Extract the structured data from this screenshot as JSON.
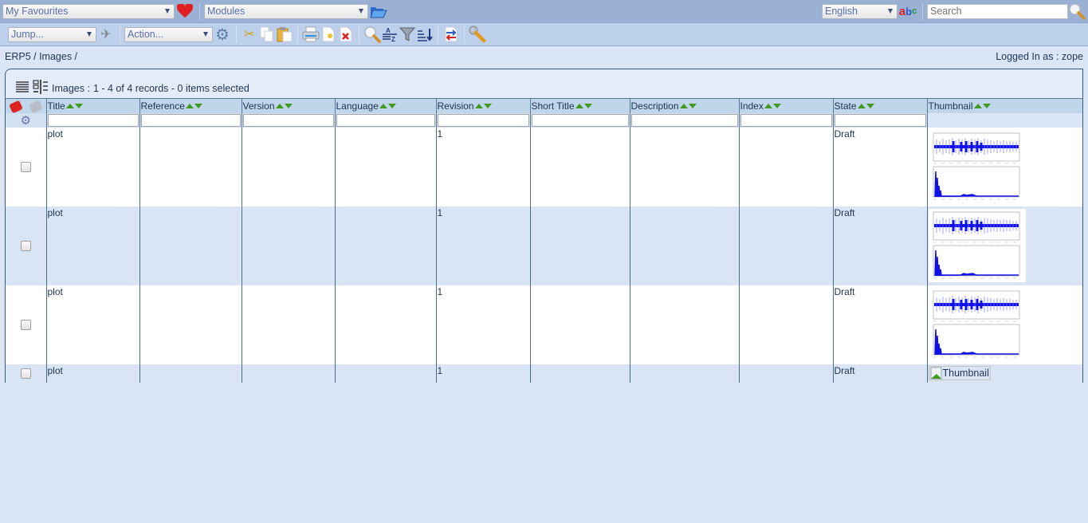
{
  "topbar": {
    "favourites": "My Favourites",
    "modules": "Modules",
    "language": "English",
    "search_placeholder": "Search"
  },
  "toolbar": {
    "jump": "Jump...",
    "action": "Action..."
  },
  "breadcrumb": "ERP5 / Images /",
  "logged_in": "Logged In as : zope",
  "listbox": {
    "title": "Images :",
    "summary": "1 - 4 of 4 records - 0 items selected",
    "columns": [
      "Title",
      "Reference",
      "Version",
      "Language",
      "Revision",
      "Short Title",
      "Description",
      "Index",
      "State",
      "Thumbnail"
    ],
    "rows": [
      {
        "title": "plot",
        "reference": "",
        "version": "",
        "language": "",
        "revision": "1",
        "short_title": "",
        "description": "",
        "index": "",
        "state": "Draft",
        "thumbnail": "image"
      },
      {
        "title": "plot",
        "reference": "",
        "version": "",
        "language": "",
        "revision": "1",
        "short_title": "",
        "description": "",
        "index": "",
        "state": "Draft",
        "thumbnail": "image"
      },
      {
        "title": "plot",
        "reference": "",
        "version": "",
        "language": "",
        "revision": "1",
        "short_title": "",
        "description": "",
        "index": "",
        "state": "Draft",
        "thumbnail": "image"
      },
      {
        "title": "plot",
        "reference": "",
        "version": "",
        "language": "",
        "revision": "1",
        "short_title": "",
        "description": "",
        "index": "",
        "state": "Draft",
        "thumbnail": "broken"
      }
    ],
    "broken_thumbnail_alt": "Thumbnail"
  }
}
